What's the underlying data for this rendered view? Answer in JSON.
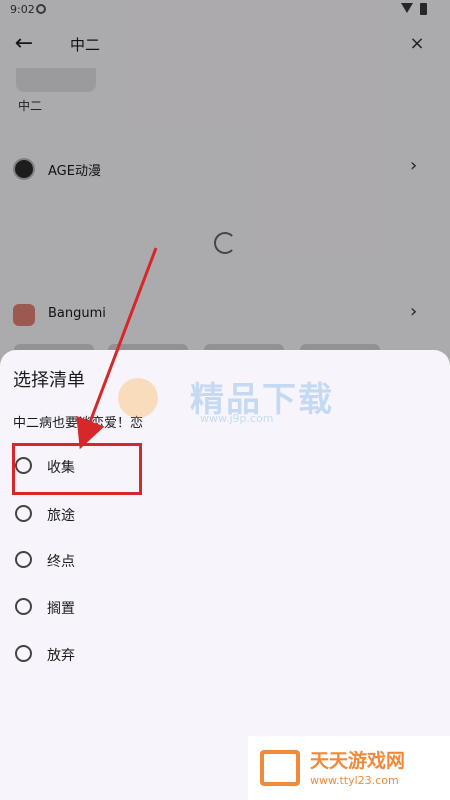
{
  "status_bar": {
    "time": "9:02"
  },
  "search": {
    "query": "中二"
  },
  "result": {
    "title": "中二"
  },
  "sources": [
    {
      "name": "AGE动漫"
    },
    {
      "name": "Bangumi"
    }
  ],
  "sheet": {
    "title": "选择清单",
    "subtitle": "中二病也要谈恋爱！恋",
    "options": [
      {
        "label": "收集",
        "selected": false
      },
      {
        "label": "旅途",
        "selected": false
      },
      {
        "label": "终点",
        "selected": false
      },
      {
        "label": "搁置",
        "selected": false
      },
      {
        "label": "放弃",
        "selected": false
      }
    ]
  },
  "watermarks": {
    "center_title": "精品下载",
    "center_url": "www.j9p.com",
    "corner_title": "天天游戏网",
    "corner_url": "www.ttyl23.com"
  },
  "colors": {
    "annotation": "#d6272b"
  }
}
